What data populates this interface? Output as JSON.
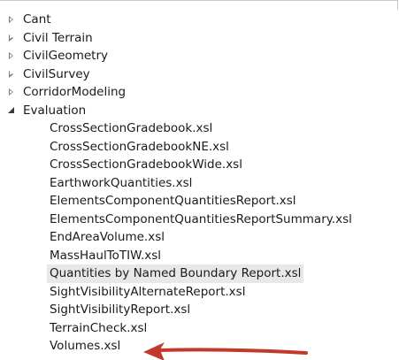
{
  "tree": {
    "nodes": [
      {
        "label": "Cant",
        "state": "collapsed"
      },
      {
        "label": "Civil Terrain",
        "state": "collapsed"
      },
      {
        "label": "CivilGeometry",
        "state": "collapsed"
      },
      {
        "label": "CivilSurvey",
        "state": "collapsed"
      },
      {
        "label": "CorridorModeling",
        "state": "collapsed"
      },
      {
        "label": "Evaluation",
        "state": "expanded"
      }
    ],
    "evaluation_children": [
      "CrossSectionGradebook.xsl",
      "CrossSectionGradebookNE.xsl",
      "CrossSectionGradebookWide.xsl",
      "EarthworkQuantities.xsl",
      "ElementsComponentQuantitiesReport.xsl",
      "ElementsComponentQuantitiesReportSummary.xsl",
      "EndAreaVolume.xsl",
      "MassHaulToTIW.xsl",
      "Quantities by Named Boundary Report.xsl",
      "SightVisibilityAlternateReport.xsl",
      "SightVisibilityReport.xsl",
      "TerrainCheck.xsl",
      "Volumes.xsl"
    ],
    "highlighted_item": "Quantities by Named Boundary Report.xsl",
    "annotated_item": "Volumes.xsl"
  },
  "colors": {
    "arrow": "#c0392b",
    "highlight": "#e8e8e8",
    "text": "#1a1a1a"
  },
  "icons": {
    "collapsed": "collapsed-triangle-icon",
    "expanded": "expanded-triangle-icon",
    "annotation": "red-arrow-icon"
  }
}
